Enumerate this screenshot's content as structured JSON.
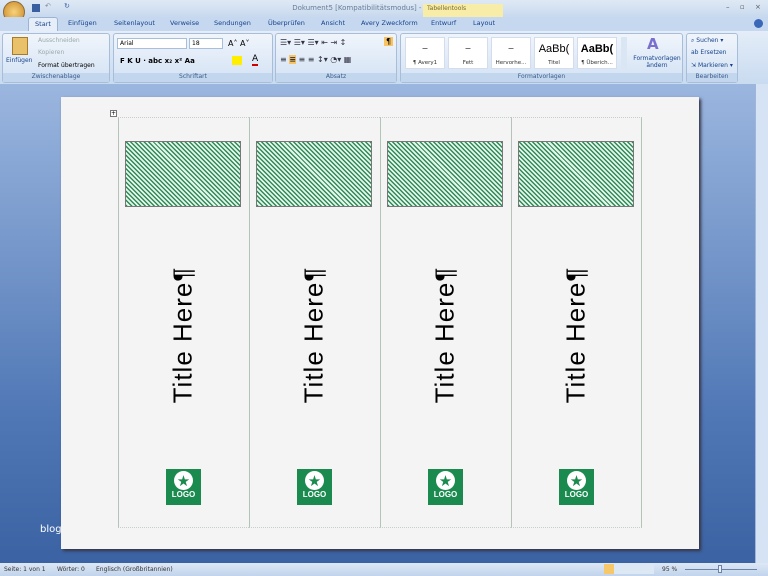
{
  "window": {
    "title": "Dokument5 [Kompatibilitätsmodus] - Microsoft Word",
    "context_tab": "Tabellentools"
  },
  "tabs": [
    "Start",
    "Einfügen",
    "Seitenlayout",
    "Verweise",
    "Sendungen",
    "Überprüfen",
    "Ansicht",
    "Avery Zweckform",
    "Entwurf",
    "Layout"
  ],
  "clipboard": {
    "paste": "Einfügen",
    "cut": "Ausschneiden",
    "copy": "Kopieren",
    "format_painter": "Format übertragen",
    "label": "Zwischenablage"
  },
  "font": {
    "name": "Arial",
    "size": "18",
    "label": "Schriftart"
  },
  "paragraph": {
    "label": "Absatz"
  },
  "styles": {
    "items": [
      {
        "preview": "",
        "name": "¶ Avery1"
      },
      {
        "preview": "",
        "name": "Fett"
      },
      {
        "preview": "",
        "name": "Hervorhe..."
      },
      {
        "preview": "AaBb(",
        "name": "Titel"
      },
      {
        "preview": "AaBb(",
        "name": "¶ Überich..."
      }
    ],
    "change": "Formatvorlagen ändern",
    "label": "Formatvorlagen"
  },
  "editing": {
    "find": "Suchen",
    "replace": "Ersetzen",
    "select": "Markieren",
    "label": "Bearbeiten"
  },
  "document": {
    "labels": [
      {
        "title": "Title Here¶",
        "logo": "LOGO"
      },
      {
        "title": "Title Here¶",
        "logo": "LOGO"
      },
      {
        "title": "Title Here¶",
        "logo": "LOGO"
      },
      {
        "title": "Title Here¶",
        "logo": "LOGO"
      }
    ],
    "watermark": "blog"
  },
  "status": {
    "page": "Seite: 1 von 1",
    "words": "Wörter: 0",
    "language": "Englisch (Großbritannien)",
    "zoom": "95 %"
  },
  "colors": {
    "label_green": "#1b8a4f",
    "hatch": "#2e8b57"
  }
}
